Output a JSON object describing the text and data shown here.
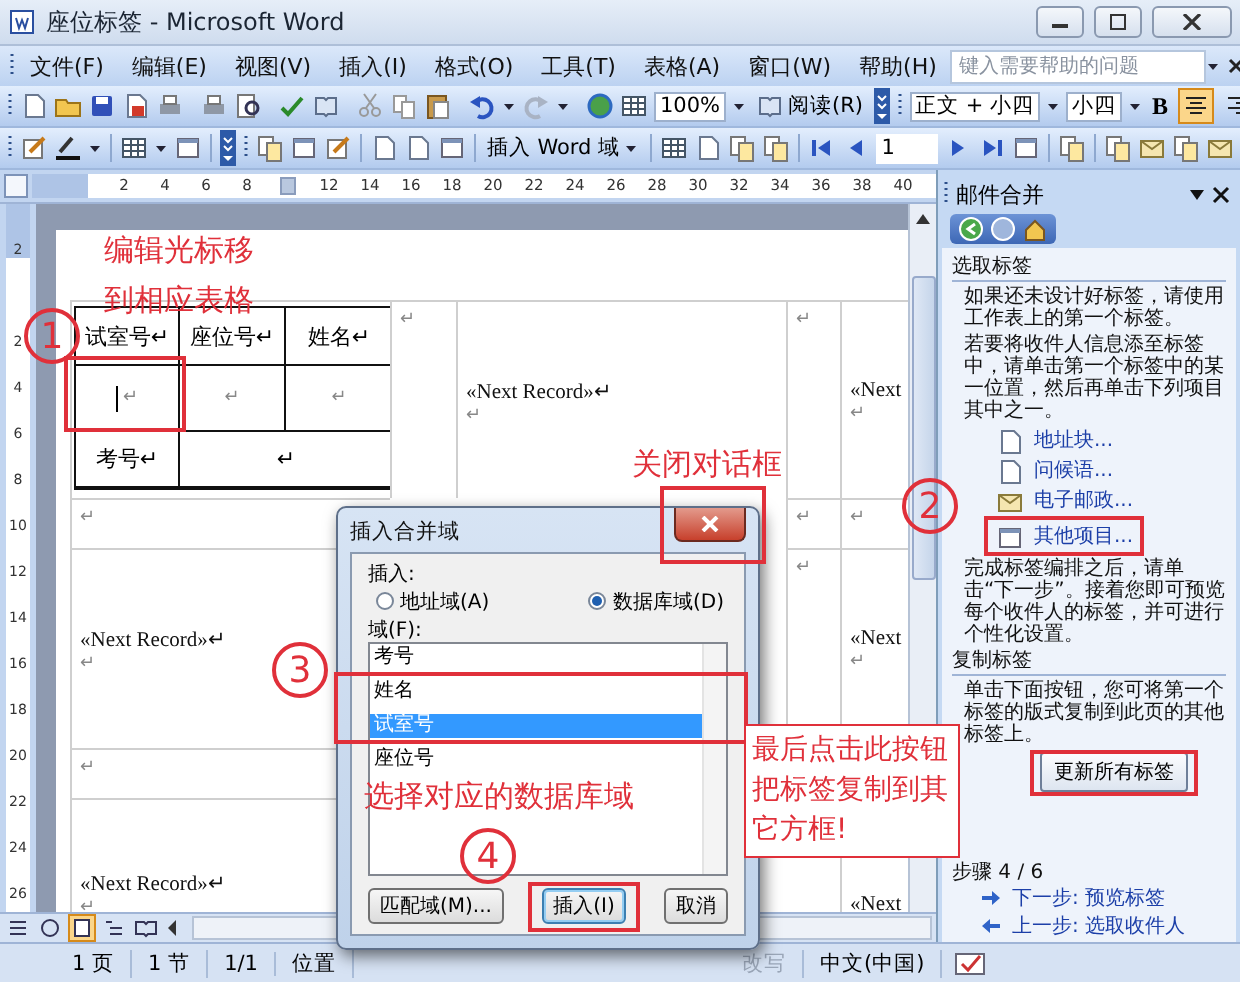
{
  "window": {
    "title": "座位标签 - Microsoft Word"
  },
  "menu_bar": {
    "items": [
      "文件(F)",
      "编辑(E)",
      "视图(V)",
      "插入(I)",
      "格式(O)",
      "工具(T)",
      "表格(A)",
      "窗口(W)",
      "帮助(H)"
    ],
    "help_field": {
      "placeholder": "键入需要帮助的问题"
    }
  },
  "standard_toolbar": {
    "zoom": "100%",
    "read_button": "阅读(R)"
  },
  "formatting_toolbar": {
    "style": "正文 + 小四",
    "font_size": "小四",
    "bold_button": "B",
    "alignment": [
      {
        "kind": "center",
        "selected": true
      },
      {
        "kind": "right",
        "selected": false
      }
    ]
  },
  "mail_merge_toolbar": {
    "insert_field_button": "插入 Word 域",
    "record": "1"
  },
  "ruler": {
    "horizontal": [
      "2",
      "4",
      "6",
      "8",
      "12",
      "14",
      "16",
      "18",
      "20",
      "22",
      "24",
      "26",
      "28",
      "30",
      "32",
      "34",
      "36",
      "38",
      "40"
    ],
    "vertical": [
      "2",
      "2",
      "4",
      "6",
      "8",
      "10",
      "12",
      "14",
      "16",
      "18",
      "20",
      "22",
      "24",
      "26"
    ]
  },
  "document": {
    "rows": [
      [
        {
          "kind": "label_table",
          "header": [
            "试室号↵",
            "座位号↵",
            "姓名↵"
          ],
          "row_2": [
            "↵",
            "↵",
            "↵"
          ],
          "row_3": [
            "考号↵",
            "↵"
          ]
        },
        {
          "kind": "text",
          "text": "↵"
        },
        {
          "kind": "record",
          "field": "«Next Record»↵",
          "mark": "↵"
        },
        {
          "kind": "text",
          "text": "↵"
        },
        {
          "kind": "record",
          "field": "«Next",
          "mark": "↵"
        }
      ],
      [
        {
          "kind": "text",
          "text": "↵"
        },
        {
          "kind": "blank"
        },
        {
          "kind": "blank"
        },
        {
          "kind": "text",
          "text": "↵"
        },
        {
          "kind": "text",
          "text": "↵"
        }
      ],
      [
        {
          "kind": "record",
          "field": "«Next Record»↵",
          "mark": "↵"
        },
        {
          "kind": "blank"
        },
        {
          "kind": "blank"
        },
        {
          "kind": "text",
          "text": "↵"
        },
        {
          "kind": "record",
          "field": "«Next",
          "mark": "↵"
        }
      ],
      [
        {
          "kind": "text",
          "text": "↵"
        },
        {
          "kind": "blank"
        },
        {
          "kind": "blank"
        },
        {
          "kind": "blank"
        },
        {
          "kind": "blank"
        }
      ],
      [
        {
          "kind": "record",
          "field": "«Next Record»↵",
          "mark": "↵"
        },
        {
          "kind": "blank"
        },
        {
          "kind": "blank"
        },
        {
          "kind": "blank"
        },
        {
          "kind": "record",
          "field": "«Next"
        }
      ]
    ]
  },
  "view_buttons": [
    {
      "kind": "normal",
      "selected": false
    },
    {
      "kind": "web",
      "selected": false
    },
    {
      "kind": "print",
      "selected": true
    },
    {
      "kind": "outline",
      "selected": false
    },
    {
      "kind": "reading",
      "selected": false
    }
  ],
  "task_pane": {
    "title": "邮件合并",
    "select_heading": "选取标签",
    "intro": "如果还未设计好标签，请使用工作表上的第一个标签。",
    "instructions": "若要将收件人信息添至标签中，请单击第一个标签中的某一位置，然后再单击下列项目其中之一。",
    "items": [
      {
        "kind": "address",
        "label": "地址块..."
      },
      {
        "kind": "greeting",
        "label": "问候语..."
      },
      {
        "kind": "postage",
        "label": "电子邮政..."
      },
      {
        "kind": "more",
        "label": "其他项目..."
      }
    ],
    "after_text": "完成标签编排之后，请单击“下一步”。接着您即可预览每个收件人的标签，并可进行个性化设置。",
    "copy_heading": "复制标签",
    "copy_text": "单击下面按钮，您可将第一个标签的版式复制到此页的其他标签上。",
    "update_button": "更新所有标签",
    "step": "步骤 4 / 6",
    "next": "下一步: 预览标签",
    "previous": "上一步: 选取收件人"
  },
  "dialog": {
    "title": "插入合并域",
    "insert_label": "插入:",
    "insert_options": [
      {
        "label": "地址域(A)",
        "selected": false
      },
      {
        "label": "数据库域(D)",
        "selected": true
      }
    ],
    "fields_label": "域(F):",
    "fields": [
      {
        "label": "考号",
        "selected": false
      },
      {
        "label": "姓名",
        "selected": false
      },
      {
        "label": "试室号",
        "selected": true
      },
      {
        "label": "座位号",
        "selected": false
      }
    ],
    "buttons": [
      {
        "label": "匹配域(M)...",
        "default": false
      },
      {
        "label": "插入(I)",
        "default": true
      },
      {
        "label": "取消",
        "default": false
      }
    ]
  },
  "status_bar": [
    {
      "text": "1 页",
      "disabled": false
    },
    {
      "text": "1 节",
      "disabled": false
    },
    {
      "text": "1/1",
      "disabled": false
    },
    {
      "text": "位置",
      "disabled": false
    },
    {
      "text": "改写",
      "disabled": true
    },
    {
      "text": "中文(中国)",
      "disabled": false
    }
  ],
  "annotations": [
    {
      "kind": "label",
      "text": "编辑光标移"
    },
    {
      "kind": "label",
      "text": "到相应表格"
    },
    {
      "kind": "step",
      "text": "1"
    },
    {
      "kind": "box"
    },
    {
      "kind": "label",
      "text": "关闭对话框"
    },
    {
      "kind": "box"
    },
    {
      "kind": "step",
      "text": "2"
    },
    {
      "kind": "box"
    },
    {
      "kind": "step",
      "text": "3"
    },
    {
      "kind": "box"
    },
    {
      "kind": "label",
      "text": "选择对应的数据库域"
    },
    {
      "kind": "step",
      "text": "4"
    },
    {
      "kind": "box"
    },
    {
      "kind": "box"
    },
    {
      "kind": "callout",
      "lines": [
        "最后点击此按钮",
        "把标签复制到其",
        "它方框!"
      ]
    }
  ]
}
